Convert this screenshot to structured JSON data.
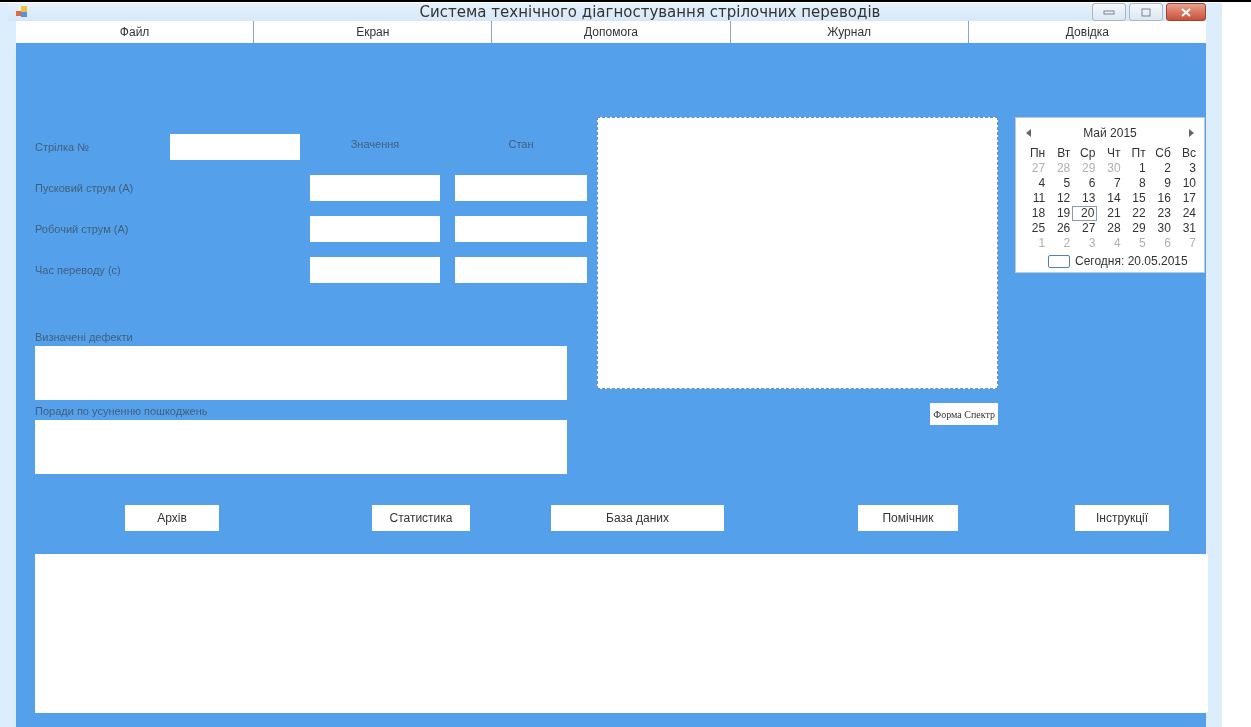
{
  "window": {
    "title": "Система технічного діагностування стрілочних переводів"
  },
  "menu": [
    {
      "label": "Файл"
    },
    {
      "label": "Екран"
    },
    {
      "label": "Допомога"
    },
    {
      "label": "Журнал"
    },
    {
      "label": "Довідка"
    }
  ],
  "form": {
    "switch_label": "Стрілка №",
    "value_header": "Значення",
    "state_header": "Стан",
    "rows": [
      {
        "label": "Пусковий струм (А)"
      },
      {
        "label": "Робочий струм (А)"
      },
      {
        "label": "Час переводу (с)"
      }
    ],
    "defects_label": "Визначені дефекти",
    "advice_label": "Поради по усуненню пошкоджень"
  },
  "spectrum_button": "Форма Спектр",
  "calendar": {
    "title": "Май 2015",
    "weekdays": [
      "Пн",
      "Вт",
      "Ср",
      "Чт",
      "Пт",
      "Сб",
      "Вс"
    ],
    "weeks": [
      [
        {
          "day": "27",
          "muted": true,
          "selected": false
        },
        {
          "day": "28",
          "muted": true,
          "selected": false
        },
        {
          "day": "29",
          "muted": true,
          "selected": false
        },
        {
          "day": "30",
          "muted": true,
          "selected": false
        },
        {
          "day": "1",
          "muted": false,
          "selected": false
        },
        {
          "day": "2",
          "muted": false,
          "selected": false
        },
        {
          "day": "3",
          "muted": false,
          "selected": false
        }
      ],
      [
        {
          "day": "4",
          "muted": false,
          "selected": false
        },
        {
          "day": "5",
          "muted": false,
          "selected": false
        },
        {
          "day": "6",
          "muted": false,
          "selected": false
        },
        {
          "day": "7",
          "muted": false,
          "selected": false
        },
        {
          "day": "8",
          "muted": false,
          "selected": false
        },
        {
          "day": "9",
          "muted": false,
          "selected": false
        },
        {
          "day": "10",
          "muted": false,
          "selected": false
        }
      ],
      [
        {
          "day": "11",
          "muted": false,
          "selected": false
        },
        {
          "day": "12",
          "muted": false,
          "selected": false
        },
        {
          "day": "13",
          "muted": false,
          "selected": false
        },
        {
          "day": "14",
          "muted": false,
          "selected": false
        },
        {
          "day": "15",
          "muted": false,
          "selected": false
        },
        {
          "day": "16",
          "muted": false,
          "selected": false
        },
        {
          "day": "17",
          "muted": false,
          "selected": false
        }
      ],
      [
        {
          "day": "18",
          "muted": false,
          "selected": false
        },
        {
          "day": "19",
          "muted": false,
          "selected": false
        },
        {
          "day": "20",
          "muted": false,
          "selected": true
        },
        {
          "day": "21",
          "muted": false,
          "selected": false
        },
        {
          "day": "22",
          "muted": false,
          "selected": false
        },
        {
          "day": "23",
          "muted": false,
          "selected": false
        },
        {
          "day": "24",
          "muted": false,
          "selected": false
        }
      ],
      [
        {
          "day": "25",
          "muted": false,
          "selected": false
        },
        {
          "day": "26",
          "muted": false,
          "selected": false
        },
        {
          "day": "27",
          "muted": false,
          "selected": false
        },
        {
          "day": "28",
          "muted": false,
          "selected": false
        },
        {
          "day": "29",
          "muted": false,
          "selected": false
        },
        {
          "day": "30",
          "muted": false,
          "selected": false
        },
        {
          "day": "31",
          "muted": false,
          "selected": false
        }
      ],
      [
        {
          "day": "1",
          "muted": true,
          "selected": false
        },
        {
          "day": "2",
          "muted": true,
          "selected": false
        },
        {
          "day": "3",
          "muted": true,
          "selected": false
        },
        {
          "day": "4",
          "muted": true,
          "selected": false
        },
        {
          "day": "5",
          "muted": true,
          "selected": false
        },
        {
          "day": "6",
          "muted": true,
          "selected": false
        },
        {
          "day": "7",
          "muted": true,
          "selected": false
        }
      ]
    ],
    "today": "Сегодня: 20.05.2015"
  },
  "buttons": [
    {
      "label": "Архів"
    },
    {
      "label": "Статистика"
    },
    {
      "label": "База даних"
    },
    {
      "label": "Помічник"
    },
    {
      "label": "Інструкції"
    }
  ]
}
